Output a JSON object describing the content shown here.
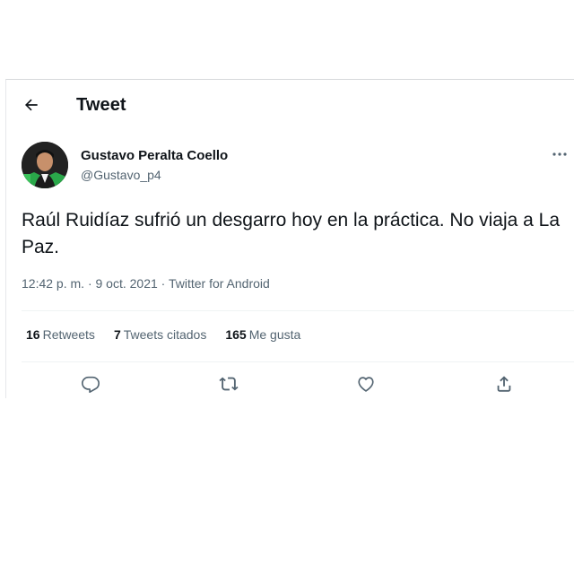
{
  "header": {
    "title": "Tweet",
    "back_icon": "arrow-left-icon"
  },
  "author": {
    "name": "Gustavo Peralta Coello",
    "handle": "@Gustavo_p4"
  },
  "tweet": {
    "text": "Raúl Ruidíaz sufrió un desgarro hoy en la práctica. No viaja a La Paz.",
    "time": "12:42 p. m.",
    "separator": "·",
    "date": "9 oct. 2021",
    "source": "Twitter for Android"
  },
  "stats": {
    "retweets_count": "16",
    "retweets_label": "Retweets",
    "quotes_count": "7",
    "quotes_label": "Tweets citados",
    "likes_count": "165",
    "likes_label": "Me gusta"
  },
  "actions": {
    "reply_icon": "reply-icon",
    "retweet_icon": "retweet-icon",
    "like_icon": "heart-icon",
    "share_icon": "share-icon"
  },
  "colors": {
    "text_primary": "#0f1419",
    "text_secondary": "#536471",
    "divider": "#eff3f4",
    "avatar_accent": "#2aa84a"
  }
}
